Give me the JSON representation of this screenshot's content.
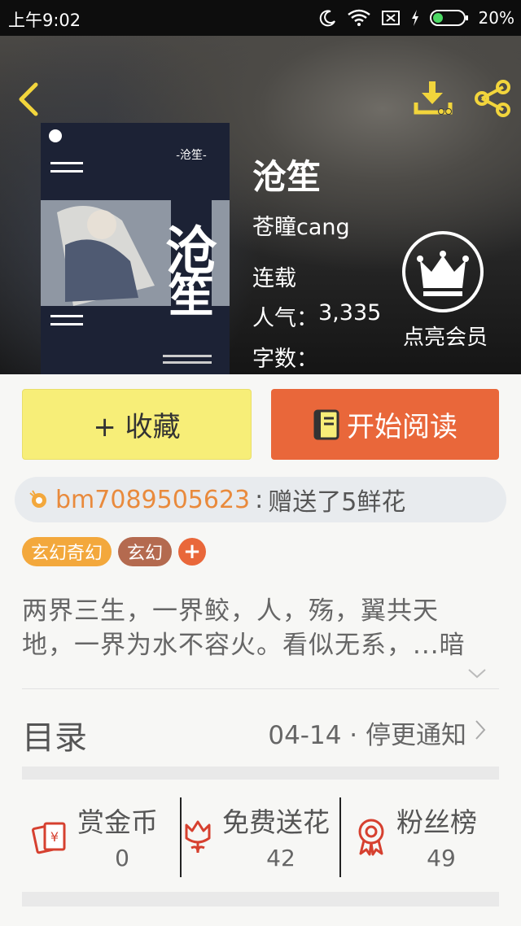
{
  "status_bar": {
    "time": "上午9:02",
    "battery_percent": "20%",
    "icons": [
      "moon-icon",
      "wifi-icon",
      "sim-off-icon",
      "charging-icon",
      "battery-icon"
    ]
  },
  "header": {
    "icons": {
      "back": "back-chevron-icon",
      "download": "download-icon",
      "share": "share-icon"
    },
    "accent_color": "#f2d53c"
  },
  "book": {
    "cover_title_text": "-沧笙-",
    "title": "沧笙",
    "author": "苍瞳cang",
    "status": "连载",
    "popularity_label": "人气：",
    "popularity_value": "3,335",
    "word_count_label": "字数："
  },
  "vip": {
    "label": "点亮会员",
    "icon": "crown-icon"
  },
  "actions": {
    "favorite_label": "+ 收藏",
    "read_label": "开始阅读",
    "read_icon": "book-icon",
    "favorite_color": "#f7ee78",
    "read_color": "#e9673a"
  },
  "gift_notice": {
    "icon": "flower-badge-icon",
    "user": "bm7089505623",
    "separator": ":",
    "message": "赠送了5鲜花"
  },
  "tags": [
    {
      "label": "玄幻奇幻",
      "color": "#f3a83c"
    },
    {
      "label": "玄幻",
      "color": "#b46a4f"
    }
  ],
  "tag_add_label": "+",
  "summary": {
    "line1": "两界三生，一界鲛，人，殇，翼共天",
    "line2": "地，一界为水不容火。看似无系，...暗"
  },
  "toc": {
    "title": "目录",
    "latest": "04-14 · 停更通知"
  },
  "stats": [
    {
      "label": "赏金币",
      "value": "0",
      "icon": "red-envelope-icon"
    },
    {
      "label": "免费送花",
      "value": "42",
      "icon": "flower-icon"
    },
    {
      "label": "粉丝榜",
      "value": "49",
      "icon": "medal-icon"
    }
  ]
}
